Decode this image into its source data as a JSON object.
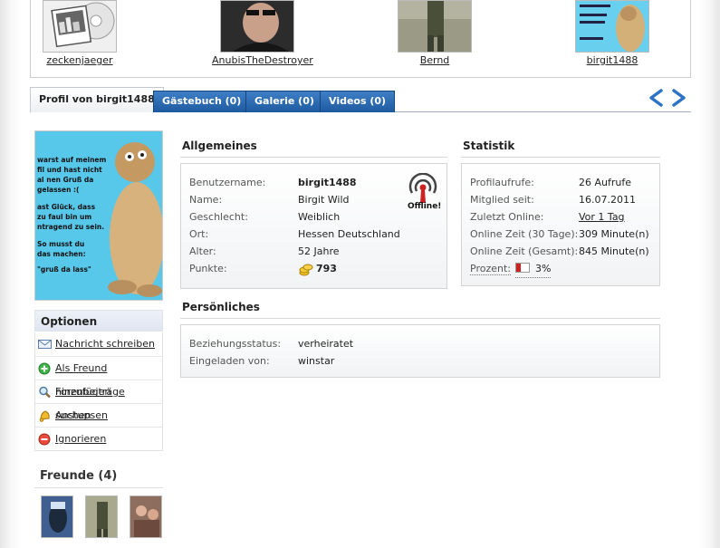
{
  "users": [
    {
      "name": "zeckenjaeger"
    },
    {
      "name": "AnubisTheDestroyer"
    },
    {
      "name": "Bernd"
    },
    {
      "name": "birgit1488"
    }
  ],
  "tabs": [
    {
      "label": "Profil von birgit1488"
    },
    {
      "label": "Gästebuch (0)"
    },
    {
      "label": "Galerie (0)"
    },
    {
      "label": "Videos (0)"
    }
  ],
  "avatar_text": [
    "warst auf meinem",
    "fil und hast nicht",
    "al nen Gruß da",
    "gelassen :(",
    "ast Glück, dass",
    "zu faul bin um",
    "ntragend zu sein.",
    "So musst du",
    "das machen:",
    "\"gruß da lass\""
  ],
  "options": {
    "title": "Optionen",
    "items": [
      {
        "label": "Nachricht schreiben",
        "icon": "envelope-icon"
      },
      {
        "label": "Als Freund hinzufügen",
        "icon": "add-friend-icon"
      },
      {
        "label": "Forenbeiträge suchen",
        "icon": "magnifier-icon"
      },
      {
        "label": "Anstupsen",
        "icon": "bell-icon"
      },
      {
        "label": "Ignorieren",
        "icon": "stop-icon"
      }
    ]
  },
  "friends": {
    "title": "Freunde (4)"
  },
  "general": {
    "title": "Allgemeines",
    "status_label": "Offline!",
    "rows": [
      {
        "label": "Benutzername:",
        "value": "birgit1488"
      },
      {
        "label": "Name:",
        "value": "Birgit Wild"
      },
      {
        "label": "Geschlecht:",
        "value": "Weiblich"
      },
      {
        "label": "Ort:",
        "value": "Hessen Deutschland"
      },
      {
        "label": "Alter:",
        "value": "52 Jahre"
      },
      {
        "label": "Punkte:",
        "value": "793"
      }
    ]
  },
  "stats": {
    "title": "Statistik",
    "rows": [
      {
        "label": "Profilaufrufe:",
        "value": "26 Aufrufe"
      },
      {
        "label": "Mitglied seit:",
        "value": "16.07.2011"
      },
      {
        "label": "Zuletzt Online:",
        "value": "Vor 1 Tag"
      },
      {
        "label": "Online Zeit (30 Tage):",
        "value": "309 Minute(n)"
      },
      {
        "label": "Online Zeit (Gesamt):",
        "value": "845 Minute(n)"
      },
      {
        "label": "Prozent:",
        "value": "3%"
      }
    ],
    "percent_fraction": 0.03
  },
  "personal": {
    "title": "Persönliches",
    "rows": [
      {
        "label": "Beziehungsstatus:",
        "value": "verheiratet"
      },
      {
        "label": "Eingeladen von:",
        "value": "winstar"
      }
    ]
  },
  "colors": {
    "tab_blue": "#2a68b0",
    "accent_red": "#cc2222",
    "box_border": "#d4d4d4"
  }
}
